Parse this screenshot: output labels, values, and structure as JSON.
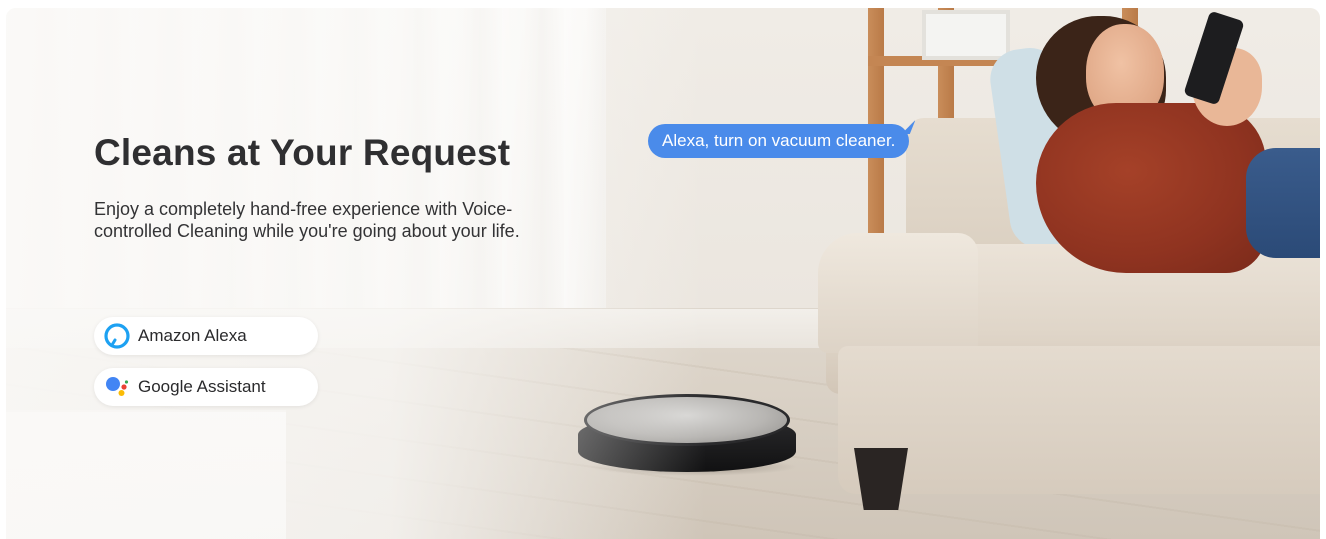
{
  "banner": {
    "headline": "Cleans at Your Request",
    "description": "Enjoy a completely hand-free experience with Voice-controlled Cleaning while you're going about your life.",
    "voice_command": "Alexa, turn on vacuum cleaner.",
    "assistants": [
      {
        "label": "Amazon Alexa",
        "icon": "amazon-alexa-icon",
        "color": "#1da1f2"
      },
      {
        "label": "Google Assistant",
        "icon": "google-assistant-icon",
        "colors": [
          "#4285f4",
          "#ea4335",
          "#fbbc05",
          "#34a853"
        ]
      }
    ],
    "colors": {
      "headline": "#2f2f31",
      "bubble": "#4a8bea",
      "bubble_text": "#ffffff"
    }
  }
}
